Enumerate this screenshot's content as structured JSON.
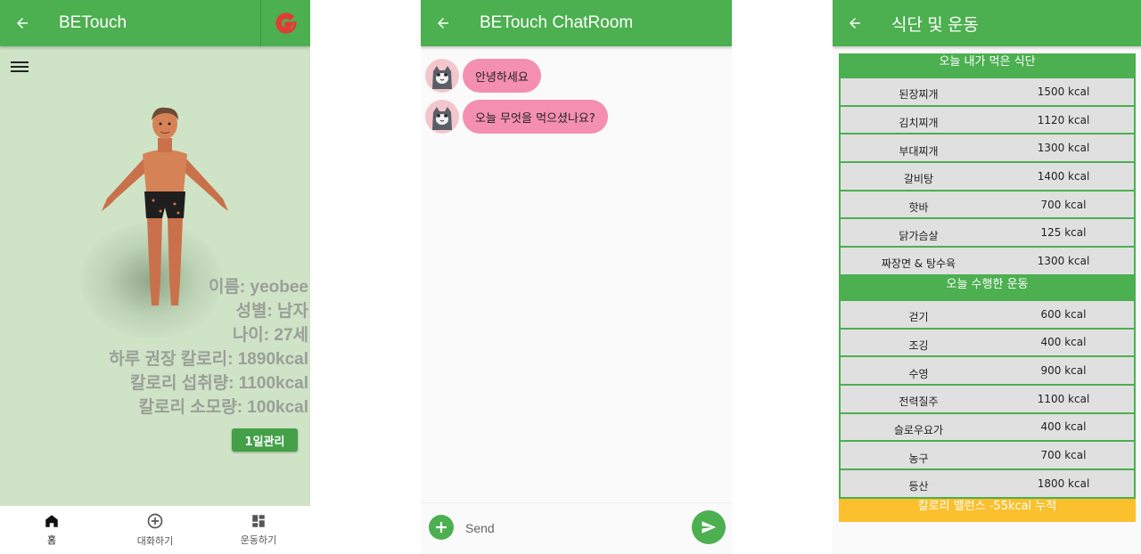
{
  "screen1": {
    "title": "BETouch",
    "info": {
      "name": "이름:     yeobee",
      "gender": "성별:      남자",
      "age": "나이:     27세",
      "recommended": "하루 권장 칼로리: 1890kcal",
      "intake": "칼로리 섭취량: 1100kcal",
      "burned": "칼로리 소모량:    100kcal"
    },
    "day_button": "1일관리",
    "nav": [
      "홈",
      "대화하기",
      "운동하기"
    ]
  },
  "screen2": {
    "title": "BETouch ChatRoom",
    "messages": [
      "안녕하세요",
      "오늘 무엇을 먹으셨나요?"
    ],
    "input_placeholder": "Send"
  },
  "screen3": {
    "title": "식단 및 운동",
    "food_header": "오늘 내가 먹은 식단",
    "foods": [
      {
        "name": "된장찌개",
        "kcal": "1500 kcal"
      },
      {
        "name": "김치찌개",
        "kcal": "1120 kcal"
      },
      {
        "name": "부대찌개",
        "kcal": "1300 kcal"
      },
      {
        "name": "갈비탕",
        "kcal": "1400 kcal"
      },
      {
        "name": "핫바",
        "kcal": "700 kcal"
      },
      {
        "name": "닭가슴살",
        "kcal": "125 kcal"
      },
      {
        "name": "짜장면 & 탕수육",
        "kcal": "1300 kcal"
      }
    ],
    "exercise_header": "오늘 수행한 운동",
    "exercises": [
      {
        "name": "걷기",
        "kcal": "600 kcal"
      },
      {
        "name": "조깅",
        "kcal": "400 kcal"
      },
      {
        "name": "수영",
        "kcal": "900 kcal"
      },
      {
        "name": "전력질주",
        "kcal": "1100 kcal"
      },
      {
        "name": "슬로우요가",
        "kcal": "400 kcal"
      },
      {
        "name": "농구",
        "kcal": "700 kcal"
      },
      {
        "name": "등산",
        "kcal": "1800 kcal"
      }
    ],
    "balance": "칼로리 밸런스 -55kcal 누적"
  },
  "colors": {
    "primary": "#4caf50",
    "bubble": "#f48fb1",
    "balance": "#fbc02d",
    "background1": "#cfe3c7"
  }
}
